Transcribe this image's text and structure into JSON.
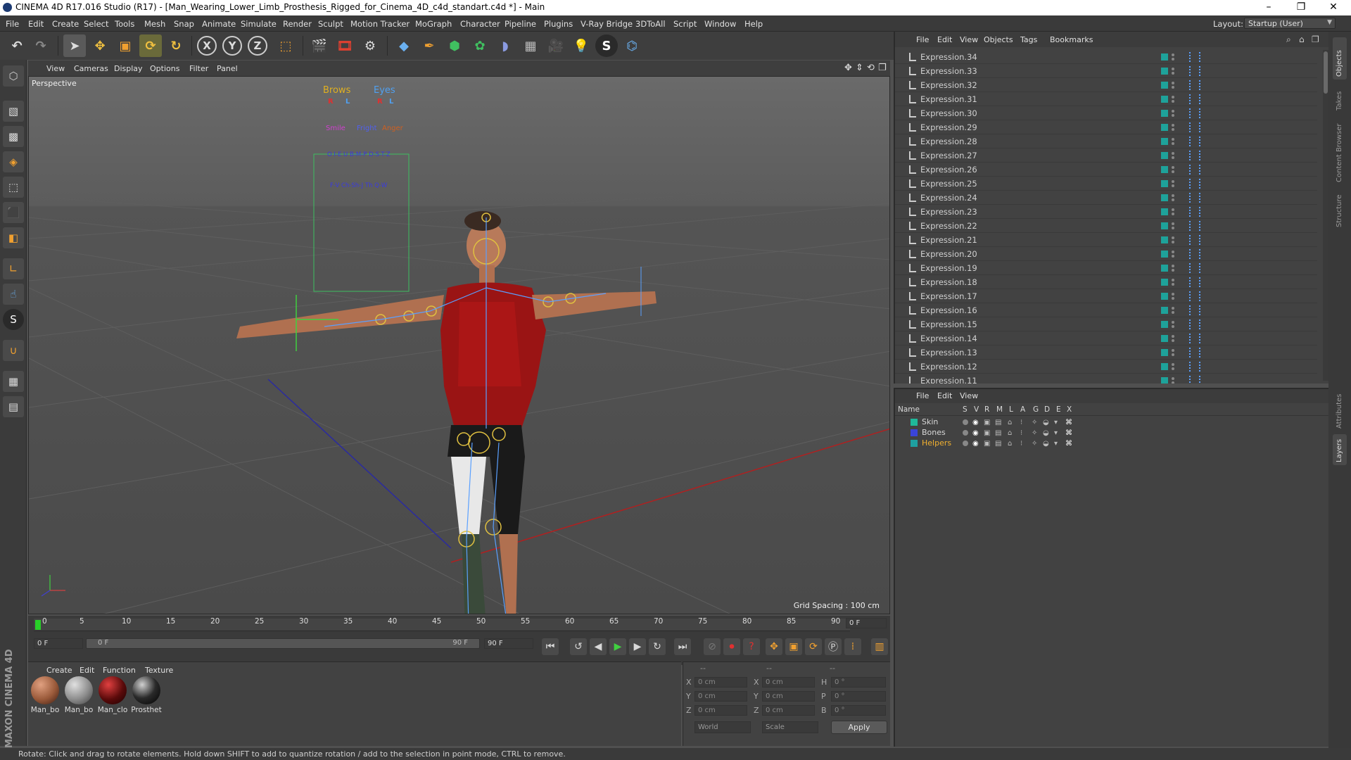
{
  "window": {
    "title": "CINEMA 4D R17.016 Studio (R17) - [Man_Wearing_Lower_Limb_Prosthesis_Rigged_for_Cinema_4D_c4d_standart.c4d *] - Main"
  },
  "menubar": {
    "items": [
      "File",
      "Edit",
      "Create",
      "Select",
      "Tools",
      "Mesh",
      "Snap",
      "Animate",
      "Simulate",
      "Render",
      "Sculpt",
      "Motion Tracker",
      "MoGraph",
      "Character",
      "Pipeline",
      "Plugins",
      "V-Ray Bridge",
      "3DToAll",
      "Script",
      "Window",
      "Help"
    ],
    "layout_label": "Layout:",
    "layout_value": "Startup (User)"
  },
  "toolbar": {
    "axis_labels": [
      "X",
      "Y",
      "Z"
    ]
  },
  "viewport": {
    "menu": [
      "View",
      "Cameras",
      "Display",
      "Options",
      "Filter",
      "Panel"
    ],
    "camera_label": "Perspective",
    "grid_spacing": "Grid Spacing : 100 cm",
    "hud": {
      "brows": "Brows",
      "eyes": "Eyes",
      "r1": "R",
      "l1": "L",
      "r2": "R",
      "l2": "L",
      "smile": "Smile",
      "fright": "Fright",
      "anger": "Anger",
      "row1": "O   I-E   U   B-M-P  D-S-T-Z",
      "row2": "F-V   Ch-Sh-J   Th   Q-W"
    }
  },
  "timeline": {
    "ticks": [
      "0",
      "5",
      "10",
      "15",
      "20",
      "25",
      "30",
      "35",
      "40",
      "45",
      "50",
      "55",
      "60",
      "65",
      "70",
      "75",
      "80",
      "85",
      "90"
    ],
    "current_frame": "0 F",
    "start_field": "0 F",
    "range_start": "0 F",
    "range_end": "90 F",
    "end_field": "90 F"
  },
  "material_manager": {
    "menu": [
      "Create",
      "Edit",
      "Function",
      "Texture"
    ],
    "materials": [
      {
        "name": "Man_bo",
        "color": "#9a5a3a"
      },
      {
        "name": "Man_bo",
        "color": "#8c8c8c"
      },
      {
        "name": "Man_clo",
        "color": "#5a0a0a"
      },
      {
        "name": "Prosthet",
        "color": "#2a2a2a"
      }
    ]
  },
  "attributes": {
    "header": [
      "--",
      "--",
      "--"
    ],
    "rows": [
      {
        "a": "X",
        "av": "0 cm",
        "b": "X",
        "bv": "0 cm",
        "c": "H",
        "cv": "0 °"
      },
      {
        "a": "Y",
        "av": "0 cm",
        "b": "Y",
        "bv": "0 cm",
        "c": "P",
        "cv": "0 °"
      },
      {
        "a": "Z",
        "av": "0 cm",
        "b": "Z",
        "bv": "0 cm",
        "c": "B",
        "cv": "0 °"
      }
    ],
    "coord_system": "World",
    "mode": "Scale",
    "apply_label": "Apply"
  },
  "object_manager": {
    "menu": [
      "File",
      "Edit",
      "View",
      "Objects",
      "Tags",
      "Bookmarks"
    ],
    "objects": [
      "Expression.34",
      "Expression.33",
      "Expression.32",
      "Expression.31",
      "Expression.30",
      "Expression.29",
      "Expression.28",
      "Expression.27",
      "Expression.26",
      "Expression.25",
      "Expression.24",
      "Expression.23",
      "Expression.22",
      "Expression.21",
      "Expression.20",
      "Expression.19",
      "Expression.18",
      "Expression.17",
      "Expression.16",
      "Expression.15",
      "Expression.14",
      "Expression.13",
      "Expression.12",
      "Expression.11"
    ]
  },
  "layer_manager": {
    "menu": [
      "File",
      "Edit",
      "View"
    ],
    "columns": [
      "Name",
      "S",
      "V",
      "R",
      "M",
      "L",
      "A",
      "G",
      "D",
      "E",
      "X"
    ],
    "layers": [
      {
        "name": "Skin",
        "color": "#1fb89a",
        "text_color": "#d8d8d8"
      },
      {
        "name": "Bones",
        "color": "#3a44d8",
        "text_color": "#d8d8d8"
      },
      {
        "name": "Helpers",
        "color": "#1fa0a0",
        "text_color": "#f0b030"
      }
    ]
  },
  "right_tabs": [
    "Objects",
    "Takes",
    "Content Browser",
    "Structure",
    "Attributes",
    "Layers"
  ],
  "branding": "MAXON CINEMA 4D",
  "status": {
    "text": "Rotate: Click and drag to rotate elements. Hold down SHIFT to add to quantize rotation / add to the selection in point mode, CTRL to remove."
  }
}
